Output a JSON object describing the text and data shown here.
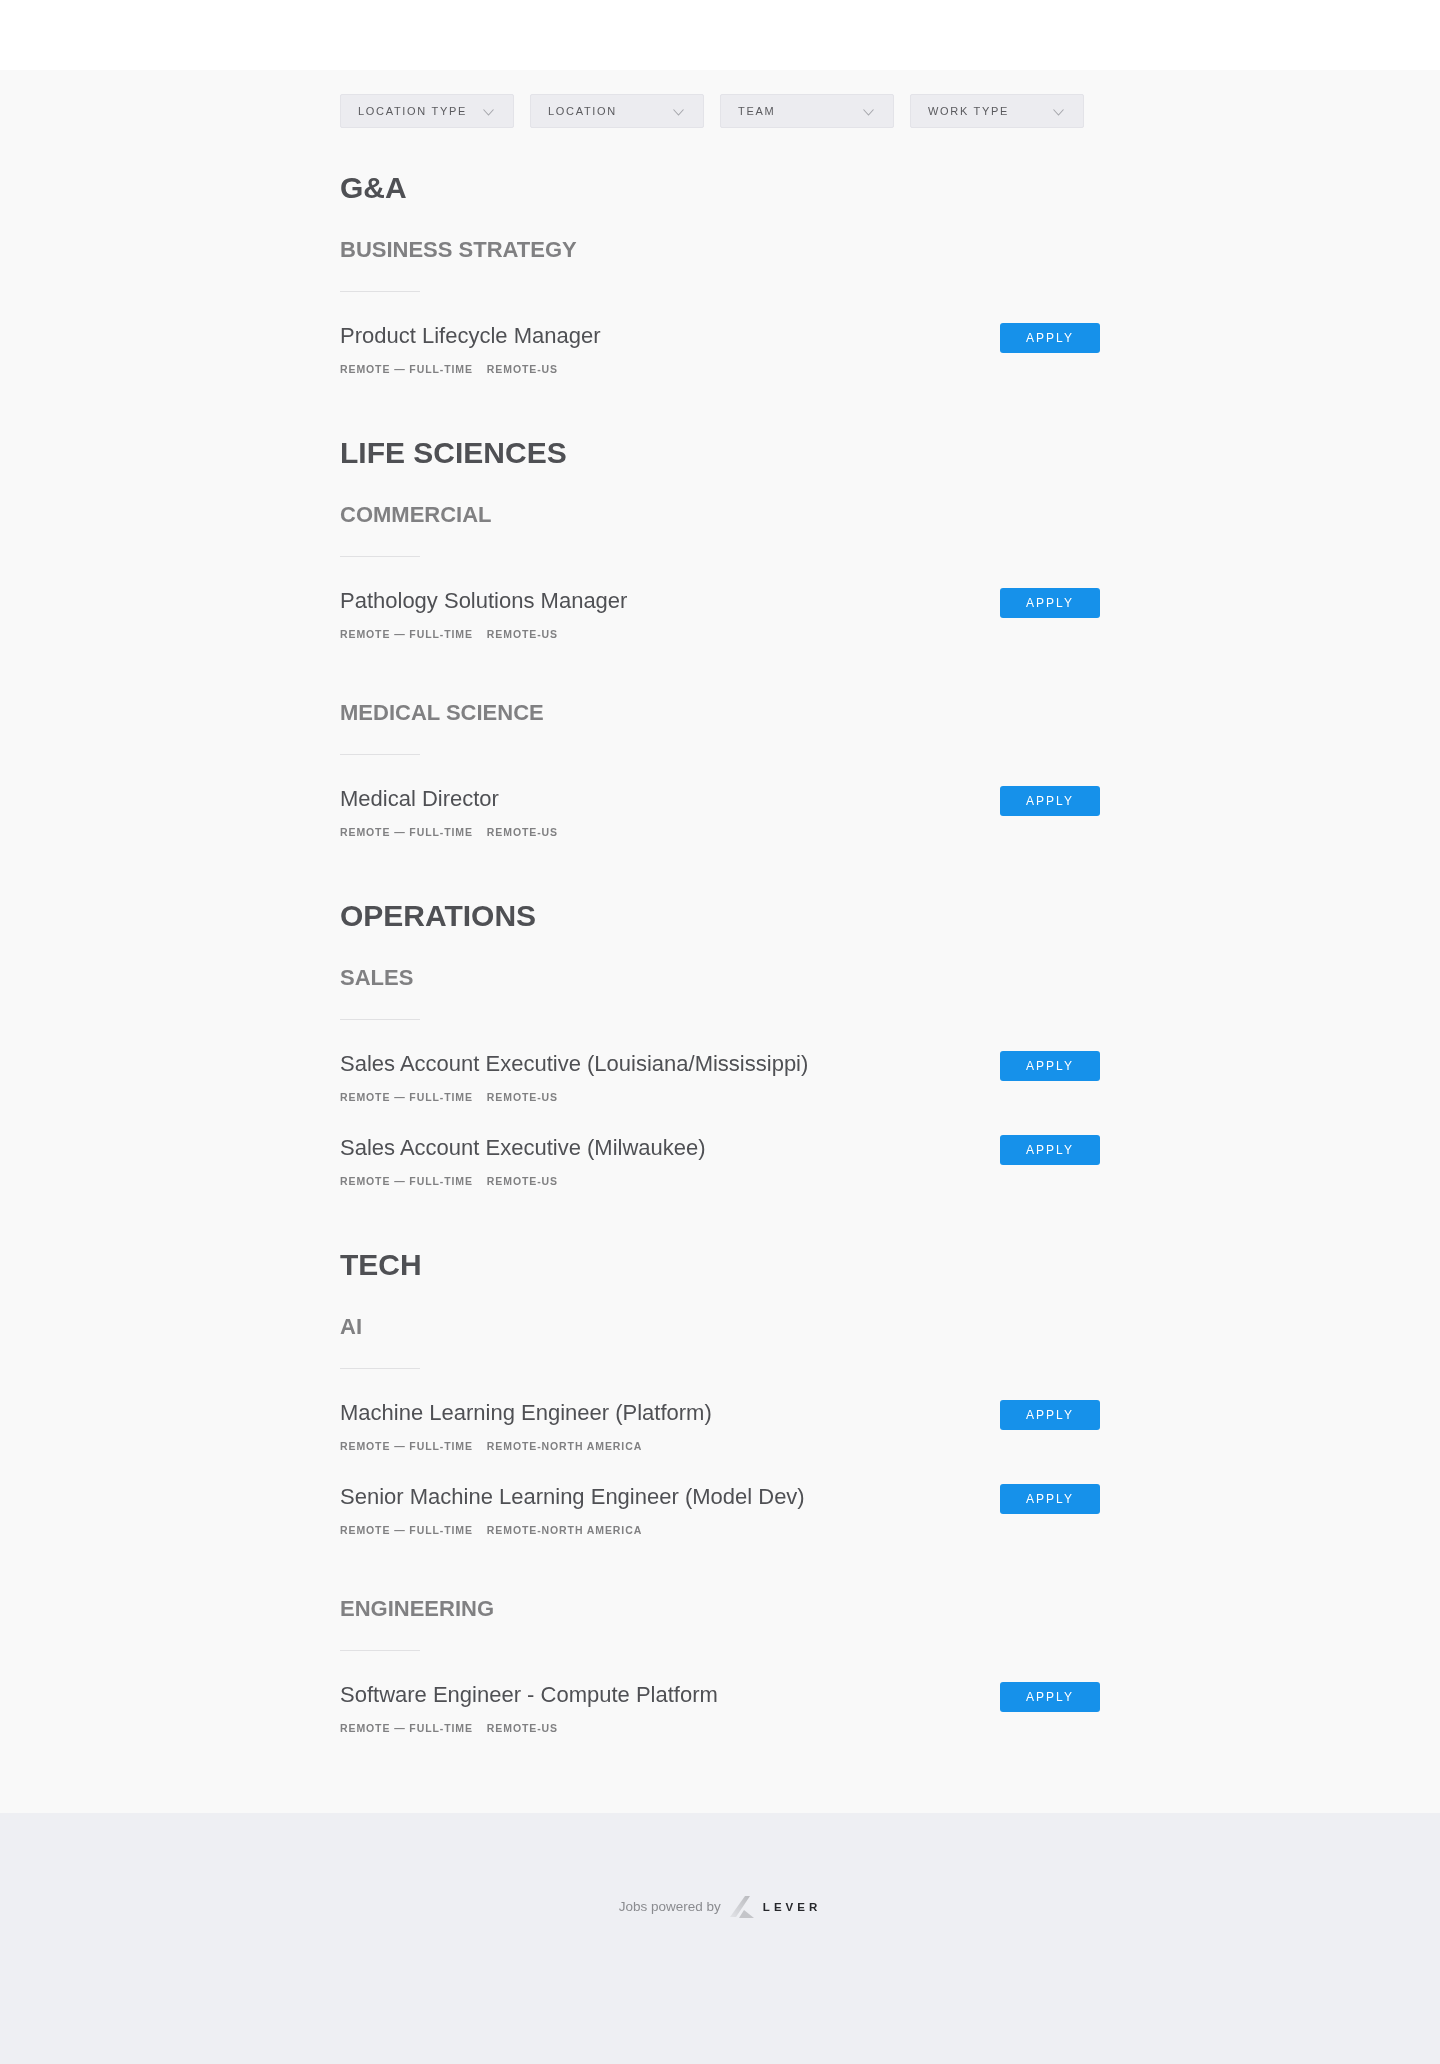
{
  "filters": [
    {
      "label": "LOCATION TYPE"
    },
    {
      "label": "LOCATION"
    },
    {
      "label": "TEAM"
    },
    {
      "label": "WORK TYPE"
    }
  ],
  "categories": [
    {
      "name": "G&A",
      "teams": [
        {
          "name": "BUSINESS STRATEGY",
          "postings": [
            {
              "title": "Product Lifecycle Manager",
              "tags": [
                "REMOTE — FULL-TIME",
                "REMOTE-US"
              ],
              "action": "APPLY"
            }
          ]
        }
      ]
    },
    {
      "name": "LIFE SCIENCES",
      "teams": [
        {
          "name": "COMMERCIAL",
          "postings": [
            {
              "title": "Pathology Solutions Manager",
              "tags": [
                "REMOTE — FULL-TIME",
                "REMOTE-US"
              ],
              "action": "APPLY"
            }
          ]
        },
        {
          "name": "MEDICAL SCIENCE",
          "postings": [
            {
              "title": "Medical Director",
              "tags": [
                "REMOTE — FULL-TIME",
                "REMOTE-US"
              ],
              "action": "APPLY"
            }
          ]
        }
      ]
    },
    {
      "name": "OPERATIONS",
      "teams": [
        {
          "name": "SALES",
          "postings": [
            {
              "title": "Sales Account Executive (Louisiana/Mississippi)",
              "tags": [
                "REMOTE — FULL-TIME",
                "REMOTE-US"
              ],
              "action": "APPLY"
            },
            {
              "title": "Sales Account Executive (Milwaukee)",
              "tags": [
                "REMOTE — FULL-TIME",
                "REMOTE-US"
              ],
              "action": "APPLY"
            }
          ]
        }
      ]
    },
    {
      "name": "TECH",
      "teams": [
        {
          "name": "AI",
          "postings": [
            {
              "title": "Machine Learning Engineer (Platform)",
              "tags": [
                "REMOTE — FULL-TIME",
                "REMOTE-NORTH AMERICA"
              ],
              "action": "APPLY"
            },
            {
              "title": "Senior Machine Learning Engineer (Model Dev)",
              "tags": [
                "REMOTE — FULL-TIME",
                "REMOTE-NORTH AMERICA"
              ],
              "action": "APPLY"
            }
          ]
        },
        {
          "name": "ENGINEERING",
          "postings": [
            {
              "title": "Software Engineer - Compute Platform",
              "tags": [
                "REMOTE — FULL-TIME",
                "REMOTE-US"
              ],
              "action": "APPLY"
            }
          ]
        }
      ]
    }
  ],
  "footer": {
    "text": "Jobs powered by",
    "logo": "LEVER"
  }
}
